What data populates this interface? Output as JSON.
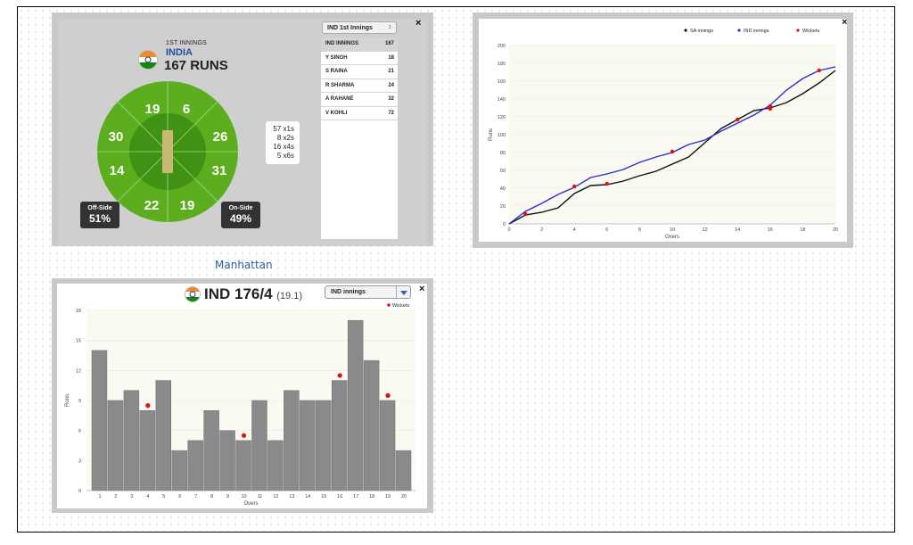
{
  "wagon": {
    "innings_label": "1ST INNINGS",
    "team": "INDIA",
    "runs": "167 RUNS",
    "sectors": [
      "19",
      "6",
      "26",
      "31",
      "19",
      "22",
      "14",
      "30"
    ],
    "off_side": {
      "label": "Off-Side",
      "pct": "51%"
    },
    "on_side": {
      "label": "On-Side",
      "pct": "49%"
    },
    "counts": [
      "57 x1s",
      "8 x2s",
      "16 x4s",
      "5 x6s"
    ],
    "selector": "IND 1st Innings",
    "selector_arrow": "↕",
    "table_header": {
      "name": "IND INNINGS",
      "value": "167"
    },
    "batsmen": [
      {
        "name": "Y SINGH",
        "runs": "18"
      },
      {
        "name": "S RAINA",
        "runs": "21"
      },
      {
        "name": "R SHARMA",
        "runs": "24"
      },
      {
        "name": "A RAHANE",
        "runs": "32"
      },
      {
        "name": "V KOHLI",
        "runs": "72"
      }
    ],
    "close": "×",
    "colors": {
      "field": "#5cae1f",
      "inner": "#3d8f12",
      "pitch": "#c9b66b"
    }
  },
  "worm": {
    "close": "×",
    "chart_data": {
      "type": "line",
      "xlabel": "Overs",
      "ylabel": "Runs",
      "xlim": [
        0,
        20
      ],
      "ylim": [
        0,
        200
      ],
      "x_ticks": [
        0,
        2,
        4,
        6,
        8,
        10,
        12,
        14,
        16,
        18,
        20
      ],
      "y_ticks": [
        0,
        20,
        40,
        60,
        80,
        100,
        120,
        140,
        160,
        180,
        200
      ],
      "legend": [
        "SA innings",
        "IND innings",
        "Wickets"
      ],
      "series": [
        {
          "name": "SA innings",
          "color": "#111111",
          "x": [
            0,
            1,
            2,
            3,
            4,
            5,
            6,
            7,
            8,
            9,
            10,
            11,
            12,
            13,
            14,
            15,
            16,
            17,
            18,
            19,
            20
          ],
          "values": [
            0,
            10,
            13,
            18,
            34,
            43,
            44,
            48,
            54,
            59,
            67,
            75,
            91,
            107,
            117,
            127,
            130,
            136,
            146,
            158,
            172
          ]
        },
        {
          "name": "IND innings",
          "color": "#2b2bdd",
          "x": [
            0,
            1,
            2,
            3,
            4,
            5,
            6,
            7,
            8,
            9,
            10,
            11,
            12,
            13,
            14,
            15,
            16,
            17,
            18,
            19,
            20
          ],
          "values": [
            0,
            14,
            23,
            33,
            41,
            52,
            56,
            61,
            69,
            75,
            80,
            89,
            94,
            104,
            113,
            122,
            133,
            150,
            163,
            172,
            176
          ]
        }
      ],
      "wickets": {
        "name": "Wickets",
        "color": "#e01010",
        "x": [
          1,
          4,
          6,
          10,
          14,
          16,
          16,
          19
        ],
        "values": [
          11,
          42,
          45,
          81,
          117,
          129,
          132,
          172
        ]
      }
    }
  },
  "manhattan": {
    "title": "Manhattan",
    "score": "IND 176/4",
    "overs": "(19.1)",
    "dropdown": "IND innings",
    "close": "×",
    "chart_data": {
      "type": "bar",
      "xlabel": "Overs",
      "ylabel": "Runs",
      "ylim": [
        0,
        18
      ],
      "y_ticks": [
        0,
        3,
        6,
        9,
        12,
        15,
        18
      ],
      "categories": [
        "1",
        "2",
        "3",
        "4",
        "5",
        "6",
        "7",
        "8",
        "9",
        "10",
        "11",
        "12",
        "13",
        "14",
        "15",
        "16",
        "17",
        "18",
        "19",
        "20"
      ],
      "values": [
        14,
        9,
        10,
        8,
        11,
        4,
        5,
        8,
        6,
        5,
        9,
        5,
        10,
        9,
        9,
        11,
        17,
        13,
        9,
        4
      ],
      "bar_color": "#8a8a8a",
      "legend": [
        "Wickets"
      ],
      "wickets": {
        "name": "Wickets",
        "color": "#e01010",
        "overs": [
          "4",
          "10",
          "16",
          "19"
        ],
        "values": [
          8.5,
          5.5,
          11.5,
          9.5
        ]
      }
    }
  }
}
